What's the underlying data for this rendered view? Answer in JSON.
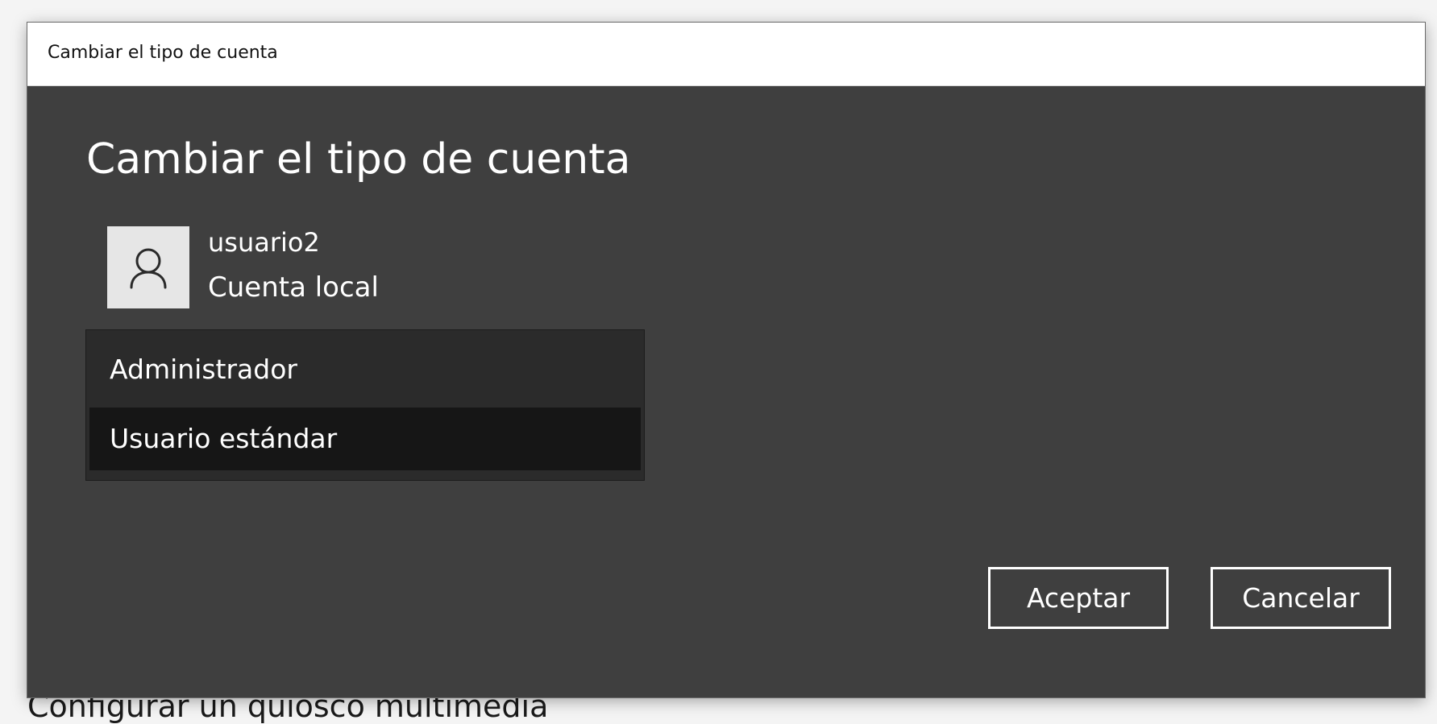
{
  "background": {
    "partial_text": "Configurar un quiosco multimedia"
  },
  "dialog": {
    "window_title": "Cambiar el tipo de cuenta",
    "heading": "Cambiar el tipo de cuenta",
    "user": {
      "name": "usuario2",
      "account_kind": "Cuenta local",
      "avatar_icon": "person-icon"
    },
    "account_types": {
      "options": [
        "Administrador",
        "Usuario estándar"
      ],
      "selected": "Usuario estándar"
    },
    "buttons": {
      "ok": "Aceptar",
      "cancel": "Cancelar"
    }
  },
  "colors": {
    "dialog_bg": "#3f3f3f",
    "titlebar_bg": "#ffffff",
    "listbox_bg": "#2b2b2b",
    "selected_option_bg": "#161616",
    "text": "#ffffff"
  }
}
